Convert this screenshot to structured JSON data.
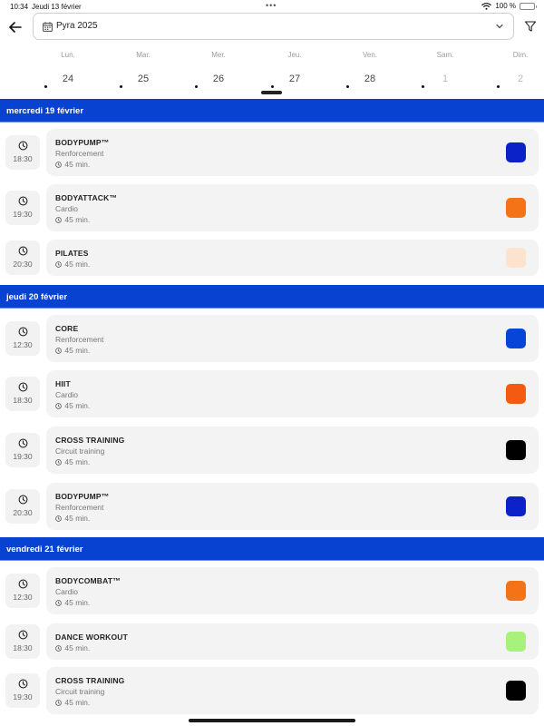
{
  "status": {
    "time": "10:34",
    "date": "Jeudi 13 février",
    "battery": "100 %"
  },
  "header": {
    "selector_label": "Pyra 2025"
  },
  "week": [
    {
      "name": "Lun.",
      "date": "24",
      "muted": false
    },
    {
      "name": "Mar.",
      "date": "25",
      "muted": false
    },
    {
      "name": "Mer.",
      "date": "26",
      "muted": false
    },
    {
      "name": "Jeu.",
      "date": "27",
      "muted": false,
      "selected": true
    },
    {
      "name": "Ven.",
      "date": "28",
      "muted": false
    },
    {
      "name": "Sam.",
      "date": "1",
      "muted": true
    },
    {
      "name": "Dim.",
      "date": "2",
      "muted": true
    }
  ],
  "sections": [
    {
      "title": "mercredi 19 février",
      "sessions": [
        {
          "time": "18:30",
          "name": "BODYPUMP™",
          "category": "Renforcement",
          "duration": "45 min.",
          "color": "#0b22c9"
        },
        {
          "time": "19:30",
          "name": "BODYATTACK™",
          "category": "Cardio",
          "duration": "45 min.",
          "color": "#f47316"
        },
        {
          "time": "20:30",
          "name": "PILATES",
          "category": "",
          "duration": "45 min.",
          "color": "#fbe3cd"
        }
      ]
    },
    {
      "title": "jeudi 20 février",
      "sessions": [
        {
          "time": "12:30",
          "name": "CORE",
          "category": "Renforcement",
          "duration": "45 min.",
          "color": "#0745d8"
        },
        {
          "time": "18:30",
          "name": "HIIT",
          "category": "Cardio",
          "duration": "45 min.",
          "color": "#f45b10"
        },
        {
          "time": "19:30",
          "name": "CROSS TRAINING",
          "category": "Circuit training",
          "duration": "45 min.",
          "color": "#000000"
        },
        {
          "time": "20:30",
          "name": "BODYPUMP™",
          "category": "Renforcement",
          "duration": "45 min.",
          "color": "#0b22c9"
        }
      ]
    },
    {
      "title": "vendredi 21 février",
      "sessions": [
        {
          "time": "12:30",
          "name": "BODYCOMBAT™",
          "category": "Cardio",
          "duration": "45 min.",
          "color": "#f47316"
        },
        {
          "time": "18:30",
          "name": "DANCE WORKOUT",
          "category": "",
          "duration": "45 min.",
          "color": "#a8f27c"
        },
        {
          "time": "19:30",
          "name": "CROSS TRAINING",
          "category": "Circuit training",
          "duration": "45 min.",
          "color": "#000000"
        }
      ]
    }
  ]
}
